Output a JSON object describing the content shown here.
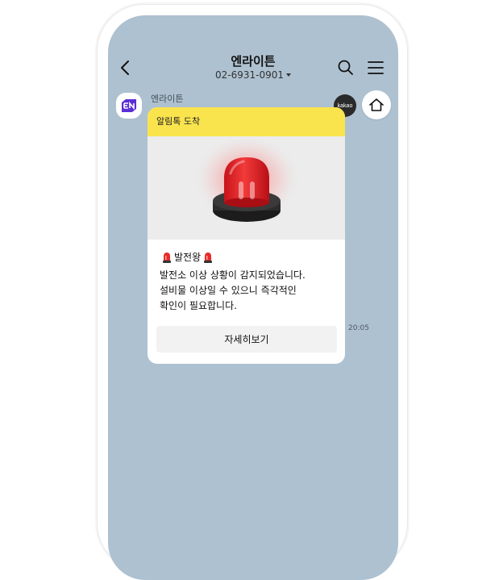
{
  "header": {
    "title": "엔라이튼",
    "phone": "02-6931-0901"
  },
  "sender": {
    "name": "엔라이튼",
    "kakao_label": "kakao"
  },
  "message": {
    "header_label": "알림톡 도착",
    "title": "발전왕",
    "body_lines": [
      "발전소 이상 상황이 감지되었습니다.",
      "설비물 이상일 수 있으니 즉각적인",
      "확인이 필요합니다."
    ],
    "button_label": "자세히보기",
    "time": "20:05"
  },
  "colors": {
    "chat_background": "#aec1d0",
    "alimtalk_yellow": "#fae44e",
    "siren_red": "#e82a2a"
  },
  "icons": [
    "back-arrow-icon",
    "search-icon",
    "menu-icon",
    "home-icon",
    "siren-icon",
    "enlighten-logo-icon"
  ]
}
